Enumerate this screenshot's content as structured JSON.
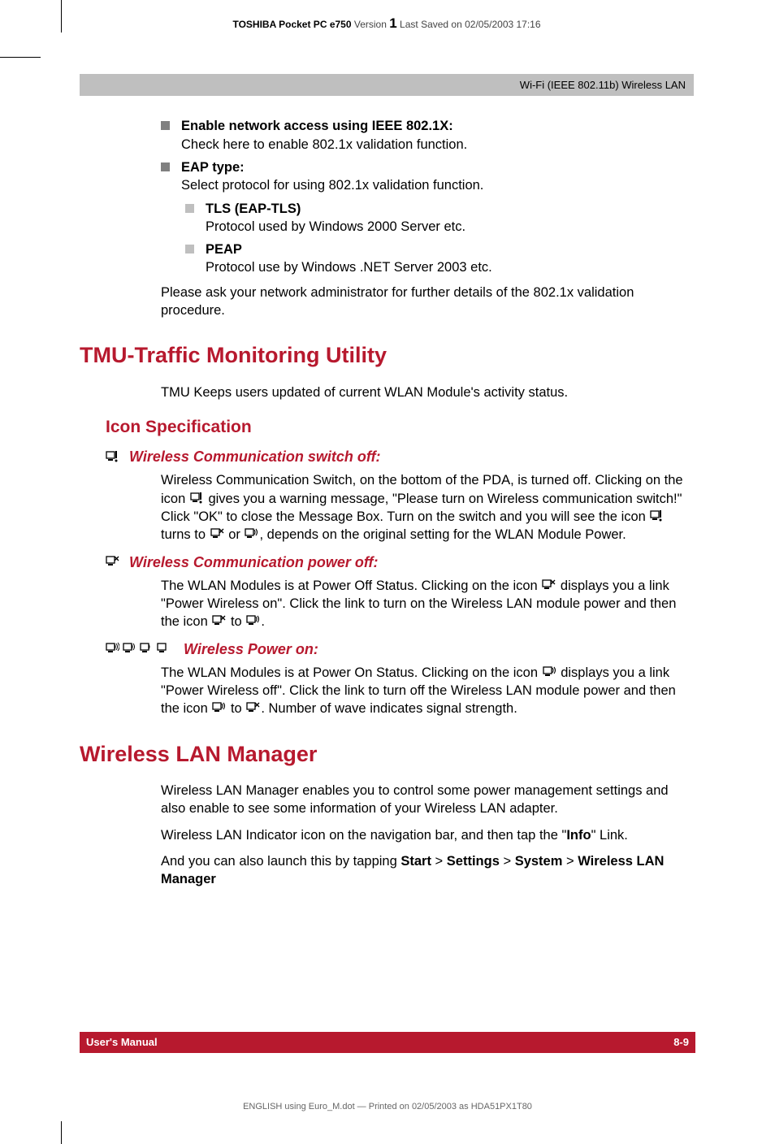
{
  "header": {
    "product": "TOSHIBA Pocket PC e750",
    "version_label": "Version",
    "version": "1",
    "saved": "Last Saved on 02/05/2003 17:16"
  },
  "grey_bar": "Wi-Fi (IEEE 802.11b) Wireless LAN",
  "bullets": {
    "enable_title": "Enable network access using IEEE 802.1X:",
    "enable_body": "Check here to enable 802.1x validation function.",
    "eap_title": "EAP type:",
    "eap_body": "Select protocol for using 802.1x validation function.",
    "tls_title": "TLS (EAP-TLS)",
    "tls_body": "Protocol used by Windows 2000 Server etc.",
    "peap_title": "PEAP",
    "peap_body": "Protocol use by Windows .NET Server 2003 etc.",
    "ask_admin": "Please ask your network administrator for further details of the 802.1x validation procedure."
  },
  "tmu": {
    "title": "TMU-Traffic Monitoring Utility",
    "intro": "TMU Keeps users updated of current WLAN Module's activity status.",
    "icon_spec": "Icon Specification",
    "switch_off_title": "Wireless Communication switch off:",
    "switch_off_p1a": "Wireless Communication Switch, on the bottom of the PDA, is turned off. Clicking on the icon ",
    "switch_off_p1b": " gives you a warning message, \"Please turn on Wireless communication switch!\" Click \"OK\" to close the Message Box. Turn on the switch and you will see the icon ",
    "switch_off_p1c": " turns to ",
    "switch_off_p1d": " or ",
    "switch_off_p1e": ", depends on the original setting for the WLAN Module Power.",
    "power_off_title": "Wireless Communication power off:",
    "power_off_p1a": "The WLAN Modules is at Power Off Status. Clicking on the icon ",
    "power_off_p1b": " displays you a link \"Power Wireless on\". Click the link to turn on the Wireless LAN module power and then the icon ",
    "power_off_p1c": " to ",
    "power_off_p1d": ".",
    "power_on_title": "Wireless Power on:",
    "power_on_p1a": "The WLAN Modules is at Power On Status. Clicking on the icon ",
    "power_on_p1b": " displays you a link \"Power Wireless off\". Click the link to turn off the Wireless LAN module power and then the icon ",
    "power_on_p1c": " to ",
    "power_on_p1d": ". Number of wave indicates signal strength."
  },
  "wlm": {
    "title": "Wireless LAN Manager",
    "p1": "Wireless LAN Manager enables you to control some power management settings and also enable to see some information of your Wireless LAN adapter.",
    "p2a": "Wireless LAN Indicator icon on the navigation bar, and then tap the \"",
    "p2b": "Info",
    "p2c": "\" Link.",
    "p3a": "And you can also launch this by tapping ",
    "p3b": "Start",
    "p3c": "Settings",
    "p3d": "System",
    "p3e": "Wireless LAN Manager",
    "gt": " > "
  },
  "footer": {
    "left": "User's Manual",
    "right": "8-9",
    "print": "ENGLISH using Euro_M.dot — Printed on 02/05/2003 as HDA51PX1T80"
  }
}
